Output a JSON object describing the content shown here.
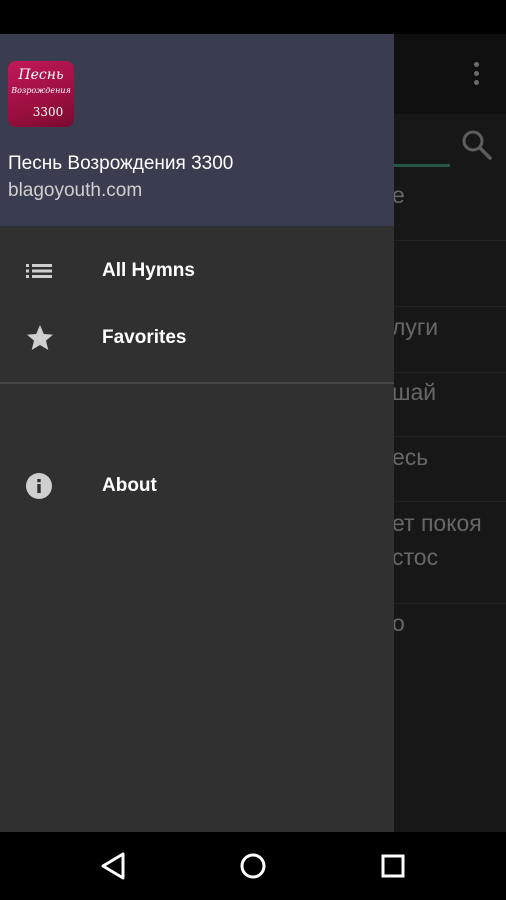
{
  "drawer": {
    "app_name": "Песнь Возрождения 3300",
    "website": "blagoyouth.com",
    "logo": {
      "line1": "Песнь",
      "line2": "Возрождения",
      "line3": "3300"
    },
    "items": [
      {
        "label": "All Hymns",
        "icon": "list-icon"
      },
      {
        "label": "Favorites",
        "icon": "star-icon"
      },
      {
        "label": "About",
        "icon": "info-icon"
      }
    ]
  },
  "background_list": {
    "items": [
      "е",
      "",
      "луги",
      "шай",
      "есь",
      "ет покоя",
      "стос",
      "о"
    ]
  },
  "system_nav": {
    "buttons": [
      "back-icon",
      "home-icon",
      "recents-icon"
    ]
  },
  "colors": {
    "drawer_header": "#3a3d4f",
    "drawer_bg": "#303030",
    "logo": "#b0134c",
    "tab_accent": "#4caf8d"
  }
}
